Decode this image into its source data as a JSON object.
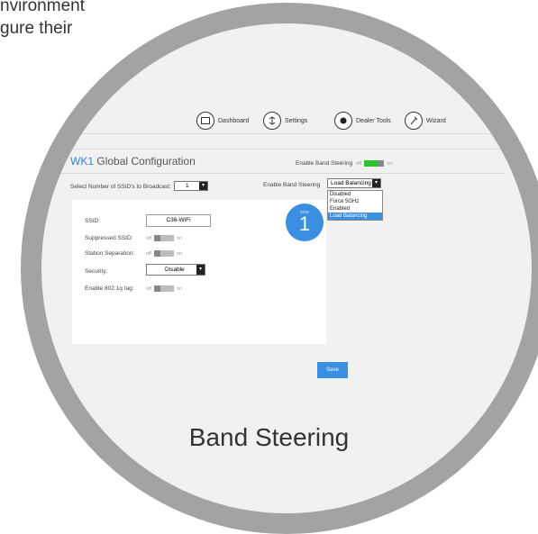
{
  "caption_top": [
    "nvironment",
    "gure their"
  ],
  "bottom_caption": "Band Steering",
  "nav": [
    {
      "label": "Dashboard",
      "icon": "dashboard-icon"
    },
    {
      "label": "Settings",
      "icon": "settings-icon"
    },
    {
      "label": "Dealer Tools",
      "icon": "dealer-tools-icon"
    },
    {
      "label": "Wizard",
      "icon": "wizard-icon"
    }
  ],
  "header": {
    "title_prefix": "WK1",
    "title": "Global Configuration",
    "band_steering_label": "Enable Band Steering",
    "toggle_off": "off",
    "toggle_on": "on"
  },
  "ssid_count": {
    "label": "Select Number of SSID's to Broadcast:",
    "value": "1"
  },
  "band_steering_select": {
    "label": "Enable Band Steering",
    "value": "Load Balancing",
    "options": [
      "Disabled",
      "Force 5GHz",
      "Enabled",
      "Load Balancing"
    ]
  },
  "ssid_badge": {
    "label": "SSID",
    "number": "1"
  },
  "form": {
    "ssid_label": "SSID:",
    "ssid_value": "C36-WiFi",
    "suppressed_label": "Suppressed SSID:",
    "separation_label": "Station Separation:",
    "security_label": "Security:",
    "security_value": "Disable",
    "tag_label": "Enable 802.1q tag:",
    "off": "off",
    "on": "on"
  },
  "save_label": "Save",
  "colors": {
    "accent": "#3a8fe0",
    "toggle_on": "#2ec02e",
    "ring": "#a3a3a3"
  }
}
